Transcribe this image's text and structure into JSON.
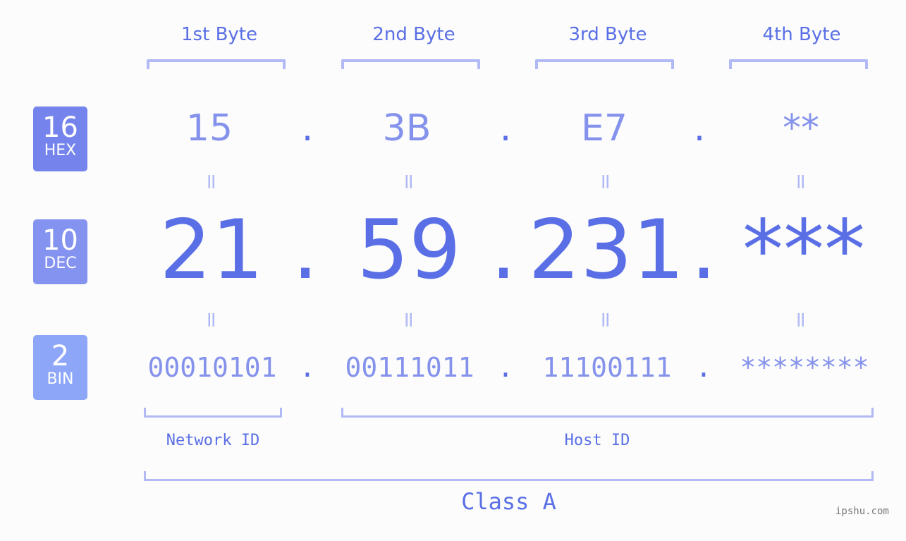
{
  "byte_headers": [
    "1st Byte",
    "2nd Byte",
    "3rd Byte",
    "4th Byte"
  ],
  "badges": {
    "hex": {
      "num": "16",
      "label": "HEX",
      "color": "#7584ec"
    },
    "dec": {
      "num": "10",
      "label": "DEC",
      "color": "#8593f0"
    },
    "bin": {
      "num": "2",
      "label": "BIN",
      "color": "#8ea6f8"
    }
  },
  "separator": ".",
  "equals": "=",
  "hex": [
    "15",
    "3B",
    "E7",
    "**"
  ],
  "dec": [
    "21",
    "59",
    "231",
    "***"
  ],
  "bin": [
    "00010101",
    "00111011",
    "11100111",
    "********"
  ],
  "labels": {
    "network_id": "Network ID",
    "host_id": "Host ID",
    "class": "Class A"
  },
  "watermark": "ipshu.com",
  "colors": {
    "accent": "#5a6fe6",
    "light_accent": "#8592ec",
    "bracket": "#b1baf6",
    "background": "#fbfcfb"
  }
}
